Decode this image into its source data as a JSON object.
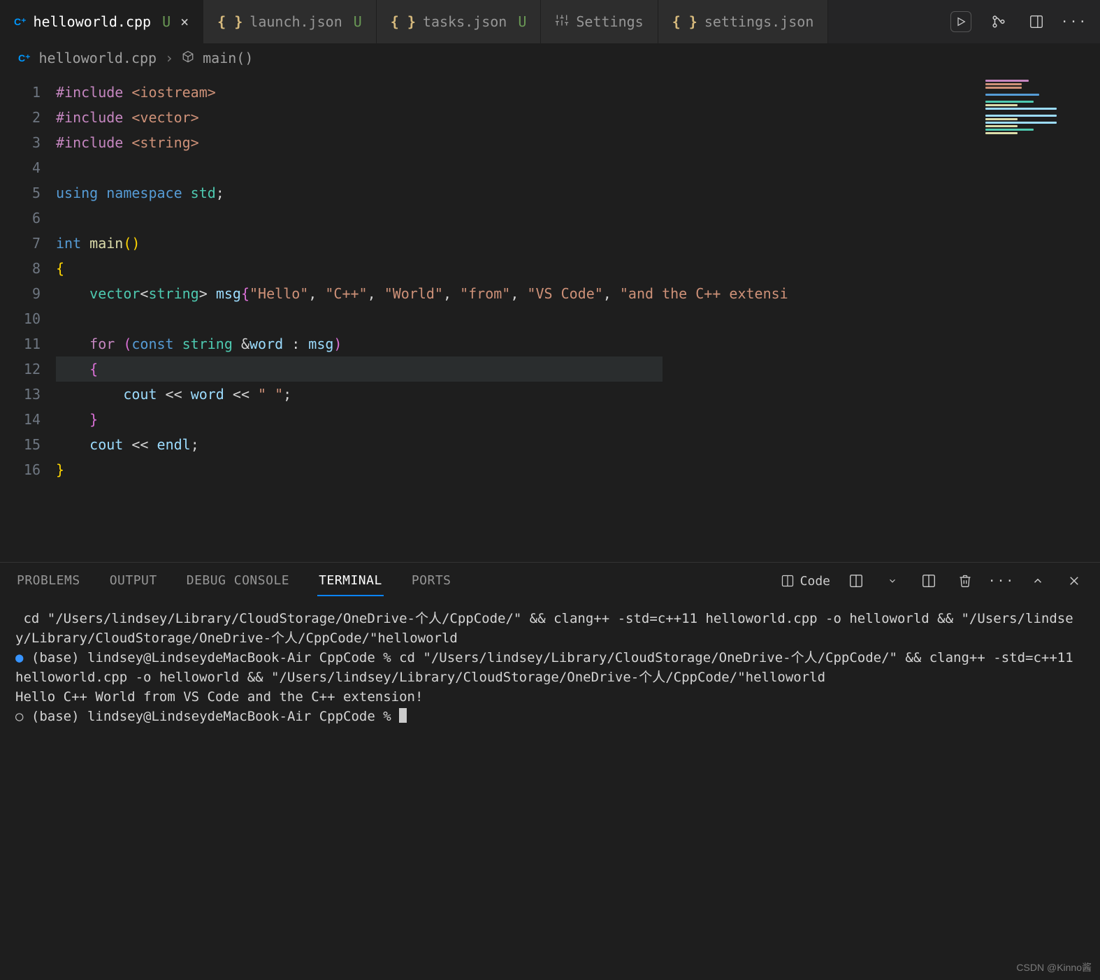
{
  "tabs": [
    {
      "label": "helloworld.cpp",
      "mod": "U",
      "icon": "cpp",
      "active": true,
      "close": true
    },
    {
      "label": "launch.json",
      "mod": "U",
      "icon": "json",
      "active": false,
      "close": false
    },
    {
      "label": "tasks.json",
      "mod": "U",
      "icon": "json",
      "active": false,
      "close": false
    },
    {
      "label": "Settings",
      "mod": "",
      "icon": "gear",
      "active": false,
      "close": false
    },
    {
      "label": "settings.json",
      "mod": "",
      "icon": "json",
      "active": false,
      "close": false
    }
  ],
  "breadcrumbs": {
    "file": "helloworld.cpp",
    "symbol": "main()"
  },
  "editor": {
    "current_line": 12,
    "lines": [
      {
        "n": 1,
        "seg": [
          [
            "tok-dir",
            "#include "
          ],
          [
            "tok-str",
            "<iostream>"
          ]
        ]
      },
      {
        "n": 2,
        "seg": [
          [
            "tok-dir",
            "#include "
          ],
          [
            "tok-str",
            "<vector>"
          ]
        ]
      },
      {
        "n": 3,
        "seg": [
          [
            "tok-dir",
            "#include "
          ],
          [
            "tok-str",
            "<string>"
          ]
        ]
      },
      {
        "n": 4,
        "seg": [
          [
            "",
            ""
          ]
        ]
      },
      {
        "n": 5,
        "seg": [
          [
            "tok-kw",
            "using "
          ],
          [
            "tok-kw",
            "namespace "
          ],
          [
            "tok-type",
            "std"
          ],
          [
            "tok-plain",
            ";"
          ]
        ]
      },
      {
        "n": 6,
        "seg": [
          [
            "",
            ""
          ]
        ]
      },
      {
        "n": 7,
        "seg": [
          [
            "tok-kw",
            "int "
          ],
          [
            "tok-fn",
            "main"
          ],
          [
            "tok-brace-y",
            "()"
          ]
        ]
      },
      {
        "n": 8,
        "seg": [
          [
            "tok-brace-y",
            "{"
          ]
        ]
      },
      {
        "n": 9,
        "seg": [
          [
            "tok-plain",
            "    "
          ],
          [
            "tok-type",
            "vector"
          ],
          [
            "tok-ang",
            "<"
          ],
          [
            "tok-type",
            "string"
          ],
          [
            "tok-ang",
            "> "
          ],
          [
            "tok-var",
            "msg"
          ],
          [
            "tok-brace-p",
            "{"
          ],
          [
            "tok-str",
            "\"Hello\""
          ],
          [
            "tok-plain",
            ", "
          ],
          [
            "tok-str",
            "\"C++\""
          ],
          [
            "tok-plain",
            ", "
          ],
          [
            "tok-str",
            "\"World\""
          ],
          [
            "tok-plain",
            ", "
          ],
          [
            "tok-str",
            "\"from\""
          ],
          [
            "tok-plain",
            ", "
          ],
          [
            "tok-str",
            "\"VS Code\""
          ],
          [
            "tok-plain",
            ", "
          ],
          [
            "tok-str",
            "\"and the C++ extensi"
          ]
        ]
      },
      {
        "n": 10,
        "seg": [
          [
            "",
            ""
          ]
        ]
      },
      {
        "n": 11,
        "seg": [
          [
            "tok-plain",
            "    "
          ],
          [
            "tok-dir",
            "for "
          ],
          [
            "tok-brace-p",
            "("
          ],
          [
            "tok-kw",
            "const "
          ],
          [
            "tok-type",
            "string "
          ],
          [
            "tok-ang",
            "&"
          ],
          [
            "tok-var",
            "word"
          ],
          [
            "tok-plain",
            " : "
          ],
          [
            "tok-var",
            "msg"
          ],
          [
            "tok-brace-p",
            ")"
          ]
        ]
      },
      {
        "n": 12,
        "seg": [
          [
            "tok-plain",
            "    "
          ],
          [
            "tok-brace-p",
            "{"
          ]
        ]
      },
      {
        "n": 13,
        "seg": [
          [
            "tok-plain",
            "        "
          ],
          [
            "tok-var",
            "cout"
          ],
          [
            "tok-plain",
            " "
          ],
          [
            "tok-ang",
            "<<"
          ],
          [
            "tok-plain",
            " "
          ],
          [
            "tok-var",
            "word"
          ],
          [
            "tok-plain",
            " "
          ],
          [
            "tok-ang",
            "<<"
          ],
          [
            "tok-plain",
            " "
          ],
          [
            "tok-str",
            "\" \""
          ],
          [
            "tok-plain",
            ";"
          ]
        ]
      },
      {
        "n": 14,
        "seg": [
          [
            "tok-plain",
            "    "
          ],
          [
            "tok-brace-p",
            "}"
          ]
        ]
      },
      {
        "n": 15,
        "seg": [
          [
            "tok-plain",
            "    "
          ],
          [
            "tok-var",
            "cout"
          ],
          [
            "tok-plain",
            " "
          ],
          [
            "tok-ang",
            "<<"
          ],
          [
            "tok-plain",
            " "
          ],
          [
            "tok-var",
            "endl"
          ],
          [
            "tok-plain",
            ";"
          ]
        ]
      },
      {
        "n": 16,
        "seg": [
          [
            "tok-brace-y",
            "}"
          ]
        ]
      }
    ]
  },
  "panel": {
    "tabs": [
      "PROBLEMS",
      "OUTPUT",
      "DEBUG CONSOLE",
      "TERMINAL",
      "PORTS"
    ],
    "active": "TERMINAL",
    "terminal_profile": "Code"
  },
  "terminal": {
    "lines": [
      {
        "prefix": "",
        "text": " cd \"/Users/lindsey/Library/CloudStorage/OneDrive-个人/CppCode/\" && clang++ -std=c++11 helloworld.cpp -o helloworld && \"/Users/lindsey/Library/CloudStorage/OneDrive-个人/CppCode/\"helloworld"
      },
      {
        "prefix": "b",
        "text": "(base) lindsey@LindseydeMacBook-Air CppCode % cd \"/Users/lindsey/Library/CloudStorage/OneDrive-个人/CppCode/\" && clang++ -std=c++11 helloworld.cpp -o helloworld && \"/Users/lindsey/Library/CloudStorage/OneDrive-个人/CppCode/\"helloworld"
      },
      {
        "prefix": "",
        "text": "Hello C++ World from VS Code and the C++ extension!"
      },
      {
        "prefix": "w",
        "text": "(base) lindsey@LindseydeMacBook-Air CppCode % ",
        "cursor": true
      }
    ]
  },
  "watermark": "CSDN @Kinno酱"
}
